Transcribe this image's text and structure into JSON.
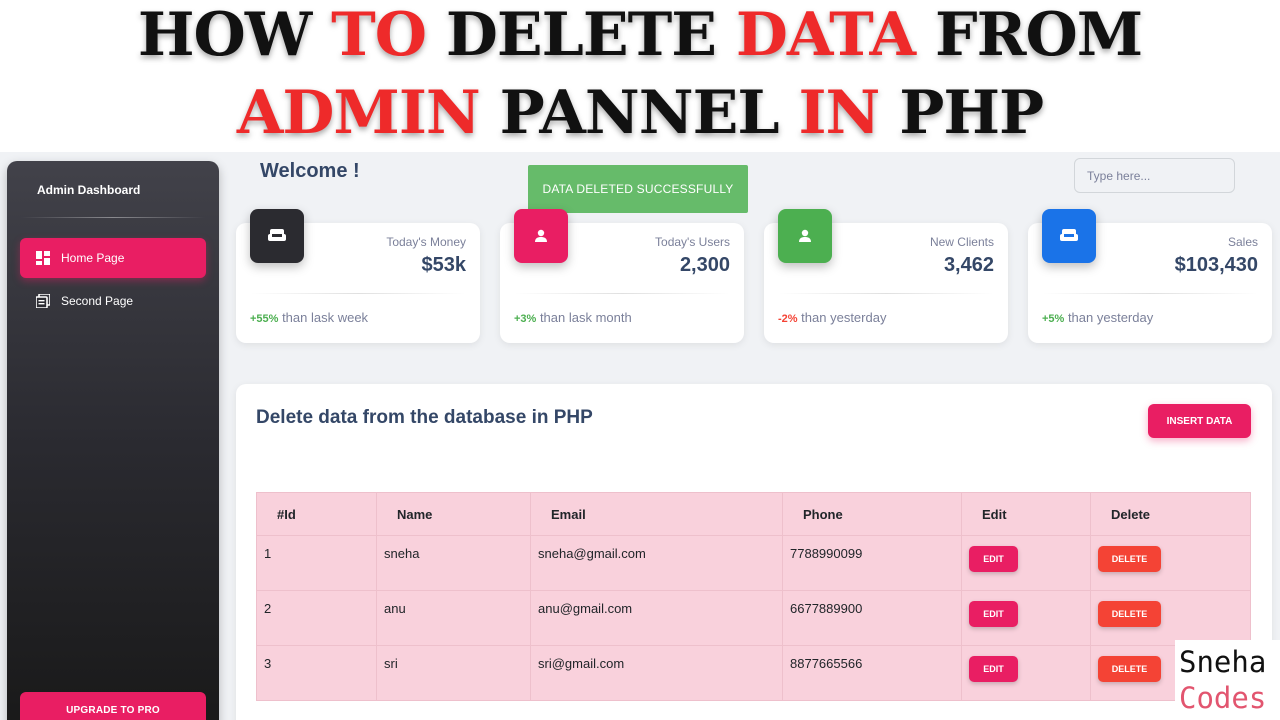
{
  "banner": {
    "line1": [
      {
        "text": "HOW ",
        "accent": false
      },
      {
        "text": "TO",
        "accent": true
      },
      {
        "text": " DELETE ",
        "accent": false
      },
      {
        "text": "DATA",
        "accent": true
      },
      {
        "text": " FROM",
        "accent": false
      }
    ],
    "line2": [
      {
        "text": "ADMIN",
        "accent": true
      },
      {
        "text": " PANNEL ",
        "accent": false
      },
      {
        "text": "IN",
        "accent": true
      },
      {
        "text": " PHP",
        "accent": false
      }
    ]
  },
  "sidebar": {
    "brand": "Admin Dashboard",
    "items": [
      {
        "label": "Home Page",
        "icon": "dashboard-icon",
        "active": true
      },
      {
        "label": "Second Page",
        "icon": "pages-icon",
        "active": false
      }
    ],
    "upgrade_label": "UPGRADE TO PRO"
  },
  "header": {
    "welcome": "Welcome !",
    "toast": "DATA DELETED SUCCESSFULLY",
    "search_placeholder": "Type here..."
  },
  "stats": [
    {
      "label": "Today's Money",
      "value": "$53k",
      "change": "+55%",
      "change_text": " than lask week",
      "trend": "positive",
      "icon": "weekend-icon",
      "color": "#2b2b30"
    },
    {
      "label": "Today's Users",
      "value": "2,300",
      "change": "+3%",
      "change_text": " than lask month",
      "trend": "positive",
      "icon": "person-icon",
      "color": "#e91e63"
    },
    {
      "label": "New Clients",
      "value": "3,462",
      "change": "-2%",
      "change_text": " than yesterday",
      "trend": "negative",
      "icon": "person-icon",
      "color": "#4caf50"
    },
    {
      "label": "Sales",
      "value": "$103,430",
      "change": "+5%",
      "change_text": " than yesterday",
      "trend": "positive",
      "icon": "weekend-icon",
      "color": "#1a73e8"
    }
  ],
  "main": {
    "title": "Delete data from the database in PHP",
    "insert_label": "INSERT DATA",
    "columns": [
      "#Id",
      "Name",
      "Email",
      "Phone",
      "Edit",
      "Delete"
    ],
    "rows": [
      {
        "id": "1",
        "name": "sneha",
        "email": "sneha@gmail.com",
        "phone": "7788990099"
      },
      {
        "id": "2",
        "name": "anu",
        "email": "anu@gmail.com",
        "phone": "6677889900"
      },
      {
        "id": "3",
        "name": "sri",
        "email": "sri@gmail.com",
        "phone": "8877665566"
      }
    ],
    "edit_label": "EDIT",
    "delete_label": "DELETE"
  },
  "watermark": {
    "line1": "Sneha",
    "line2": "Codes"
  },
  "colors": {
    "primary": "#e91e63",
    "success": "#4caf50",
    "danger": "#f44335",
    "toast": "#66bb6a",
    "table_bg": "#f9d1dc"
  }
}
